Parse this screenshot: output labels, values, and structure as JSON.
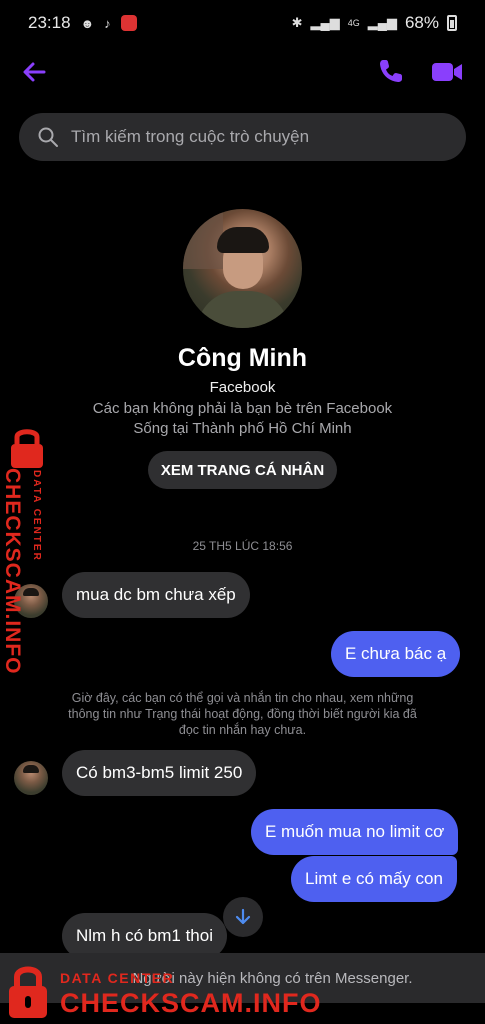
{
  "status_bar": {
    "time": "23:18",
    "network": "4G",
    "battery": "68%"
  },
  "search": {
    "placeholder": "Tìm kiếm trong cuộc trò chuyện"
  },
  "profile": {
    "name": "Công Minh",
    "source": "Facebook",
    "friend_status": "Các bạn không phải là bạn bè trên Facebook",
    "location": "Sống tại Thành phố Hồ Chí Minh",
    "view_profile_label": "XEM TRANG CÁ NHÂN"
  },
  "chat": {
    "timestamp": "25 TH5 LÚC 18:56",
    "system_note": "Giờ đây, các bạn có thể gọi và nhắn tin cho nhau, xem những thông tin như Trạng thái hoạt động, đồng thời biết người kia đã đọc tin nhắn hay chưa.",
    "messages": [
      {
        "from": "them",
        "text": "mua dc bm chưa xếp"
      },
      {
        "from": "me",
        "text": "E chưa bác ạ"
      },
      {
        "from": "them",
        "text": "Có bm3-bm5 limit 250"
      },
      {
        "from": "me",
        "text": "E muốn mua no limit cơ"
      },
      {
        "from": "me",
        "text": "Limt e có mấy con"
      },
      {
        "from": "them",
        "text": "Nlm h có bm1 thoi"
      }
    ]
  },
  "bottom_banner": {
    "text": "Người này hiện không có trên Messenger."
  },
  "watermark": {
    "brand": "CHECKSCAM.INFO",
    "tagline": "DATA CENTER"
  },
  "colors": {
    "background": "#000000",
    "accent": "#8a3ffc",
    "outgoing_bubble": "#4e60f0",
    "incoming_bubble": "#303032",
    "watermark": "#e0281e"
  }
}
